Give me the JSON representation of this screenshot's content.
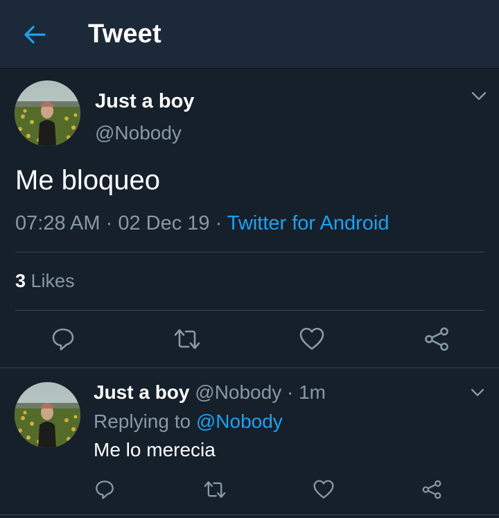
{
  "header": {
    "title": "Tweet"
  },
  "tweet": {
    "author_name": "Just a boy",
    "author_handle": "@Nobody",
    "text": "Me bloqueo",
    "time": "07:28 AM",
    "sep1": " · ",
    "date": "02 Dec 19",
    "sep2": " · ",
    "source": "Twitter for Android",
    "likes_count": "3",
    "likes_label": " Likes"
  },
  "reply": {
    "author_name": "Just a boy",
    "author_handle": "@Nobody",
    "sep": " · ",
    "age": "1m",
    "replying_prefix": "Replying to ",
    "replying_to": "@Nobody",
    "text": "Me lo merecia"
  },
  "colors": {
    "background": "#15202b",
    "header": "#1c2938",
    "accent": "#1da1f2",
    "muted": "#8899a6",
    "divider": "#38444d"
  },
  "icons": {
    "back": "arrow-left-icon",
    "menu": "chevron-down-icon",
    "reply": "comment-icon",
    "retweet": "retweet-icon",
    "like": "heart-icon",
    "share": "share-icon"
  }
}
